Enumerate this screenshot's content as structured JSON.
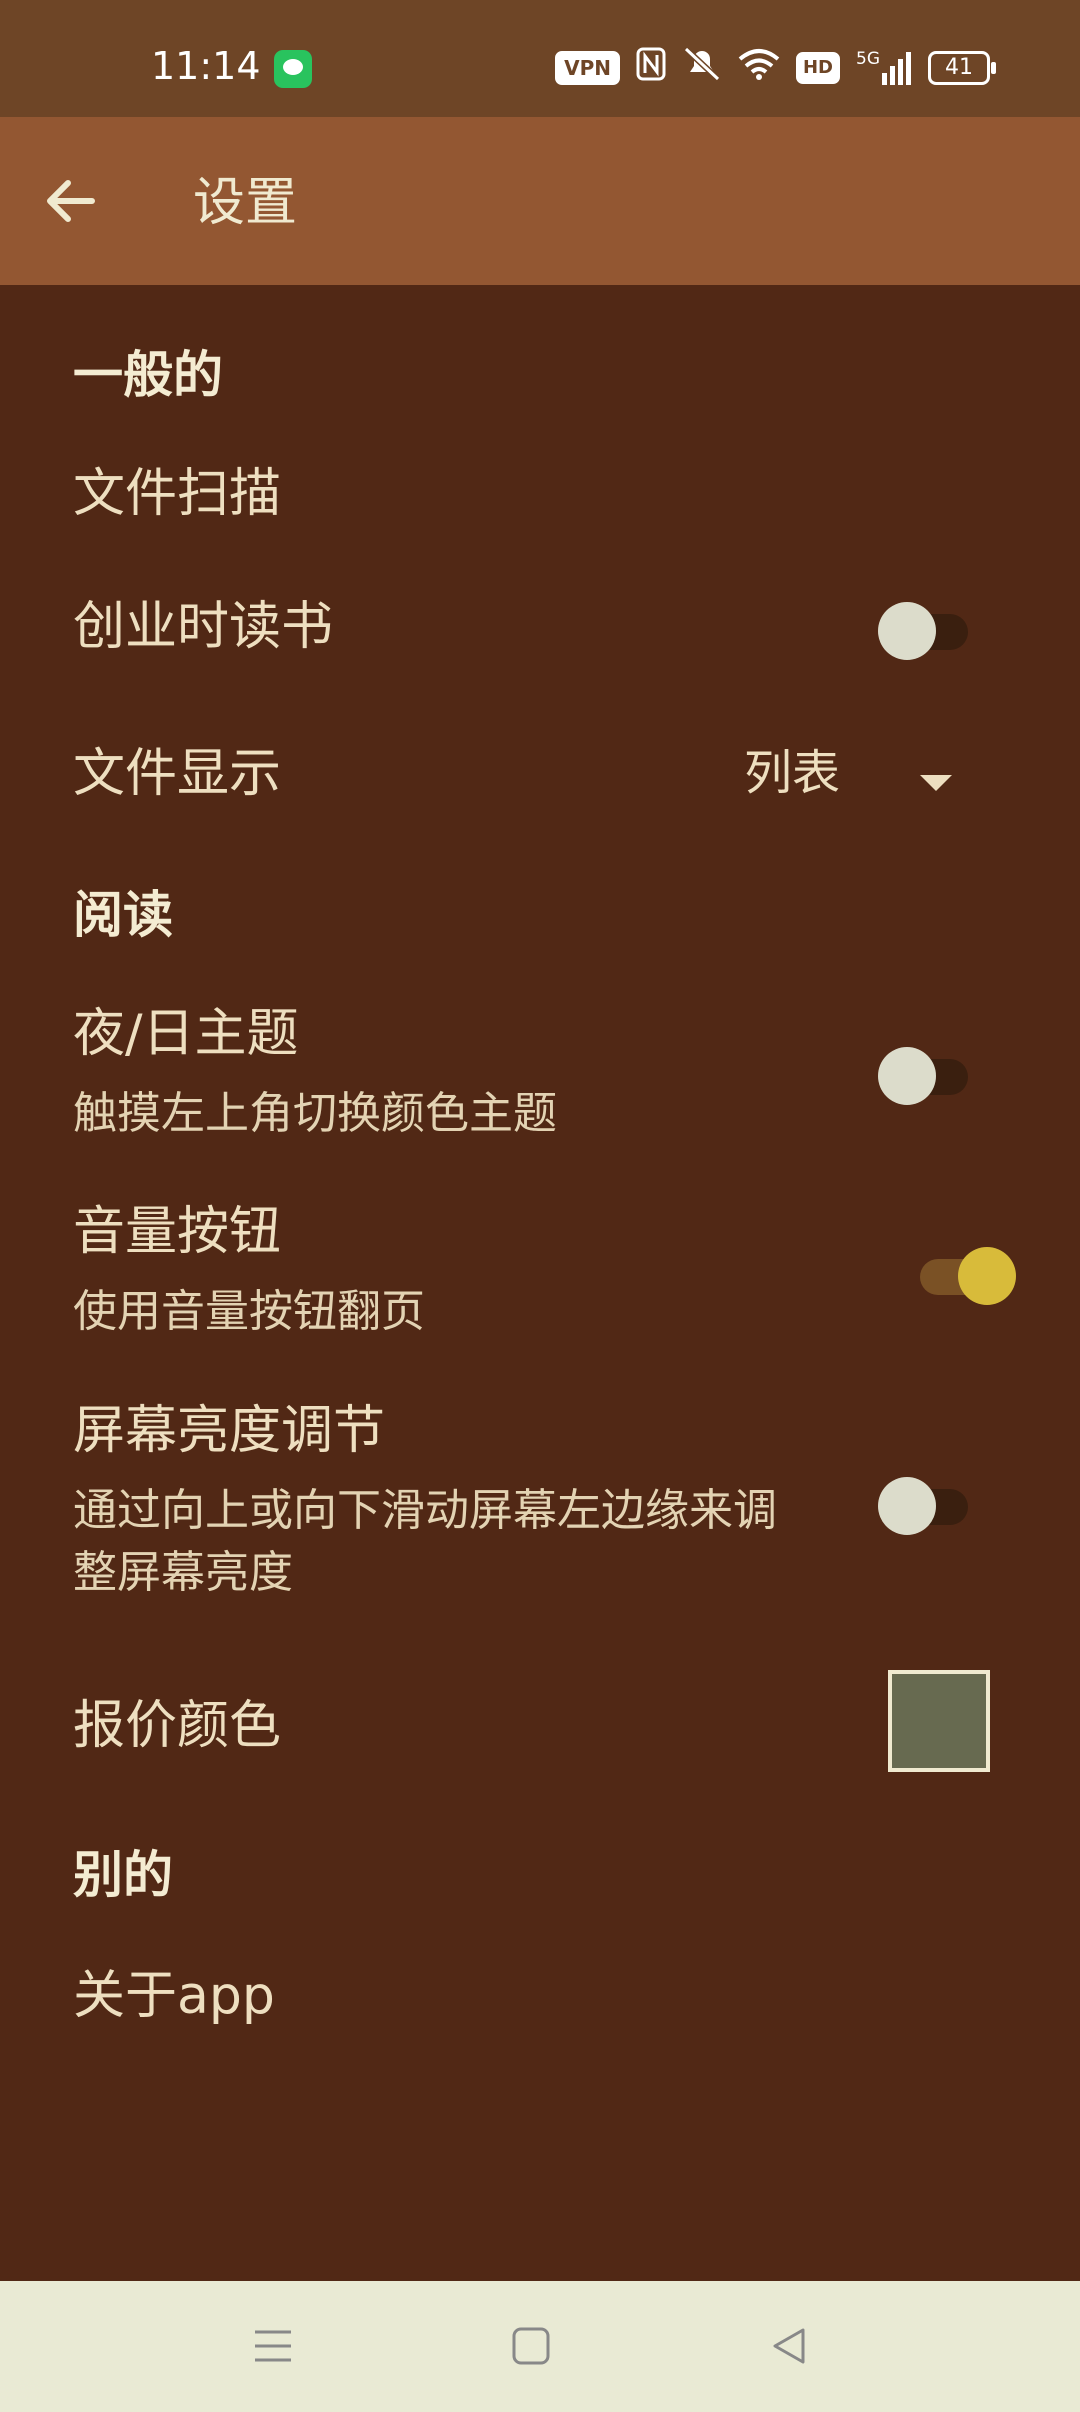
{
  "status_bar": {
    "time": "11:14",
    "vpn": "VPN",
    "hd": "HD",
    "network": "5G",
    "battery": "41"
  },
  "app_bar": {
    "title": "设置"
  },
  "sections": {
    "general": {
      "header": "一般的",
      "file_scan": "文件扫描",
      "read_on_launch": {
        "title": "创业时读书",
        "enabled": false
      },
      "file_display": {
        "title": "文件显示",
        "value": "列表"
      }
    },
    "reading": {
      "header": "阅读",
      "night_day_theme": {
        "title": "夜/日主题",
        "subtitle": "触摸左上角切换颜色主题",
        "enabled": false
      },
      "volume_buttons": {
        "title": "音量按钮",
        "subtitle": "使用音量按钮翻页",
        "enabled": true
      },
      "brightness": {
        "title": "屏幕亮度调节",
        "subtitle_line1": "通过向上或向下滑动屏幕左边缘来调",
        "subtitle_line2": "整屏幕亮度",
        "enabled": false
      },
      "price_color": {
        "title": "报价颜色",
        "color": "#676a50"
      }
    },
    "other": {
      "header": "别的",
      "about": "关于app"
    }
  },
  "colors": {
    "status_bar": "#6e4526",
    "app_bar": "#935732",
    "background": "#512815",
    "accent": "#d8bb3a",
    "nav_bar": "#e9ead4"
  },
  "icons": {
    "back": "arrow-left-icon",
    "nav_menu": "menu-icon",
    "nav_home": "home-icon",
    "nav_back": "back-triangle-icon"
  }
}
